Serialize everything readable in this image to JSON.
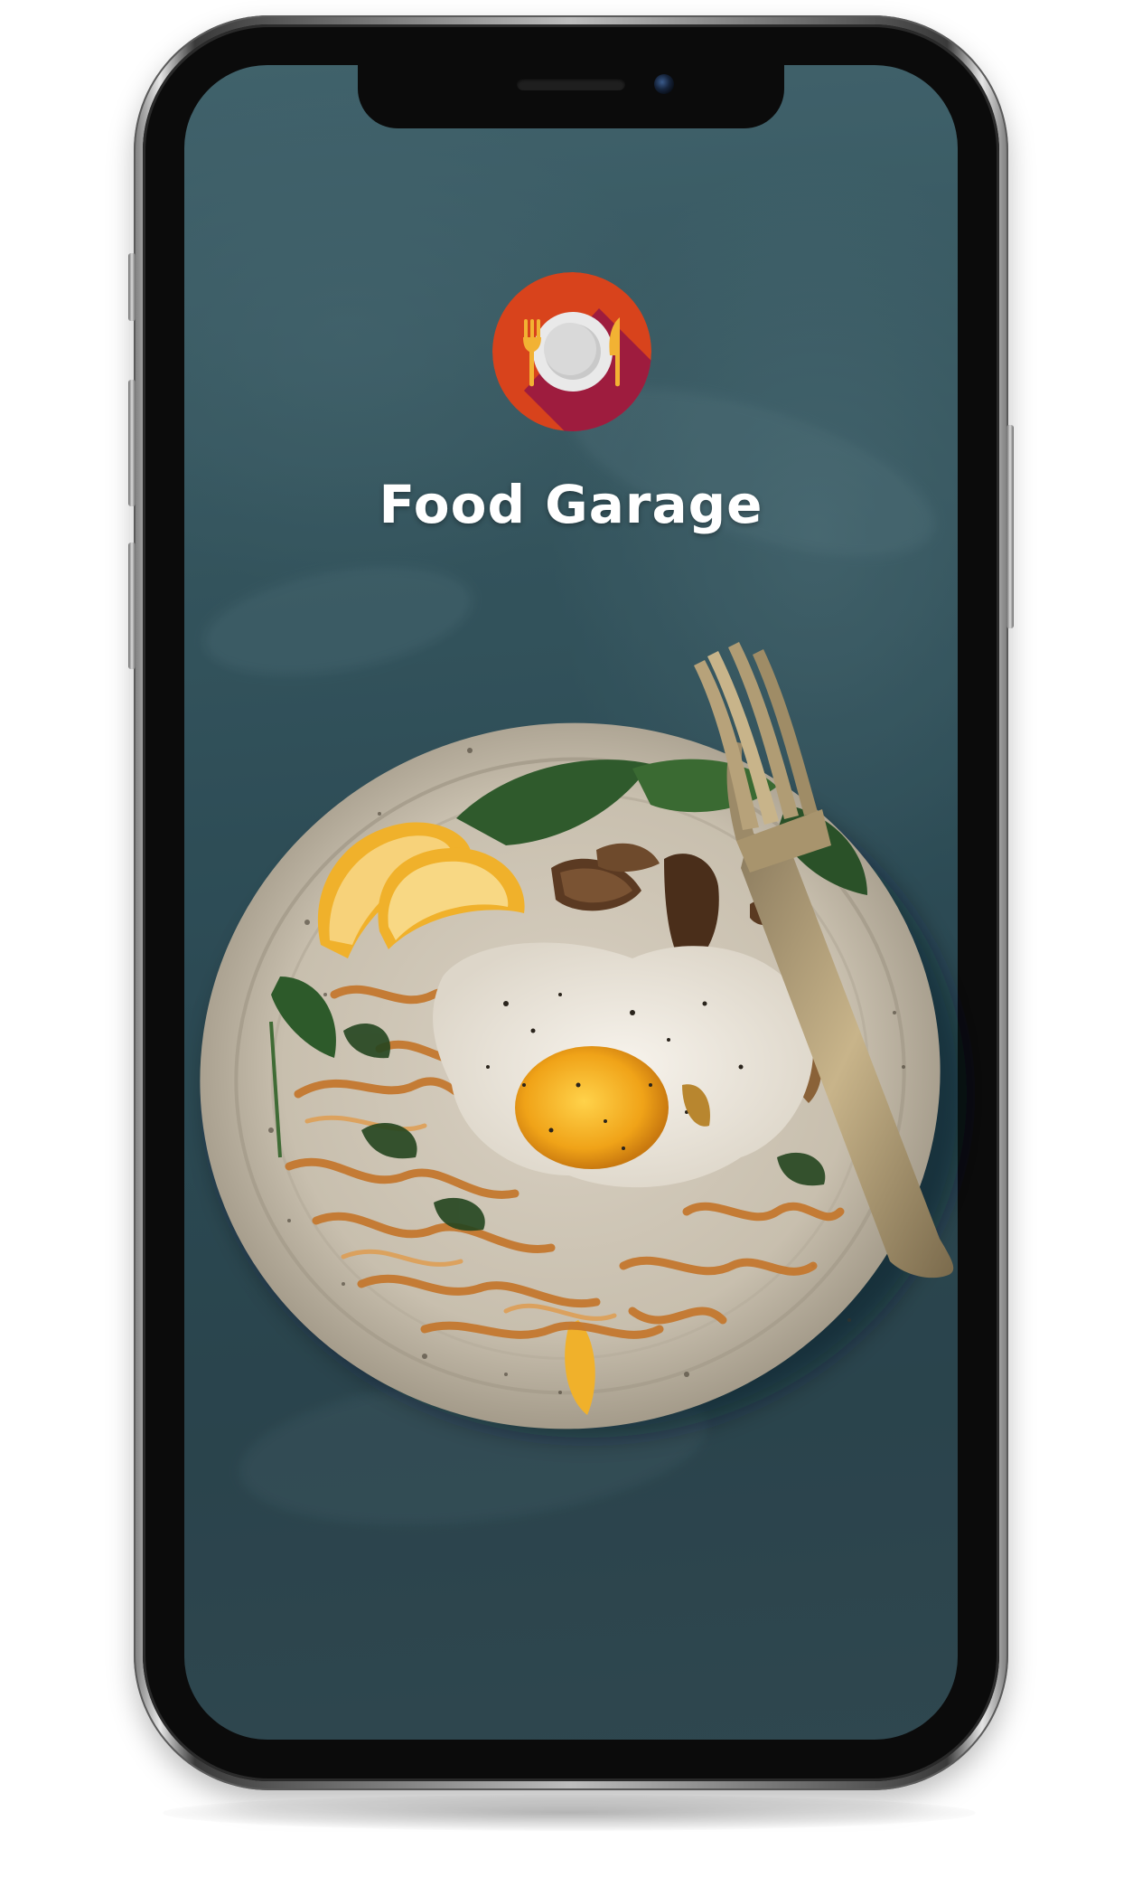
{
  "app": {
    "title": "Food Garage"
  },
  "logo": {
    "icon": "plate-fork-knife-icon",
    "colors": {
      "circle": "#d8431c",
      "shadow": "#9e1c3e",
      "plate": "#e9e9e9",
      "utensils": "#f2b233"
    }
  },
  "background": {
    "image": "plate-of-noodles-with-fried-egg-photo",
    "accent": "#3f6671"
  }
}
